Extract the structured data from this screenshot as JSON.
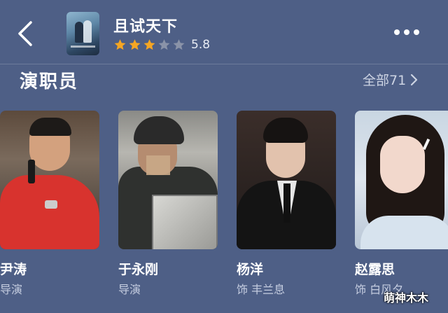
{
  "header": {
    "title": "且试天下",
    "rating_score": "5.8",
    "rating_stars": 3,
    "rating_max_stars": 5,
    "star_filled_color": "#f6a623",
    "star_empty_color": "#8a93a8"
  },
  "section": {
    "title": "演职员",
    "see_all": "全部71"
  },
  "cast": [
    {
      "name": "尹涛",
      "role": "导演"
    },
    {
      "name": "于永刚",
      "role": "导演"
    },
    {
      "name": "杨洋",
      "role": "饰 丰兰息"
    },
    {
      "name": "赵露思",
      "role": "饰 白风夕"
    }
  ],
  "watermark": "萌神木木"
}
